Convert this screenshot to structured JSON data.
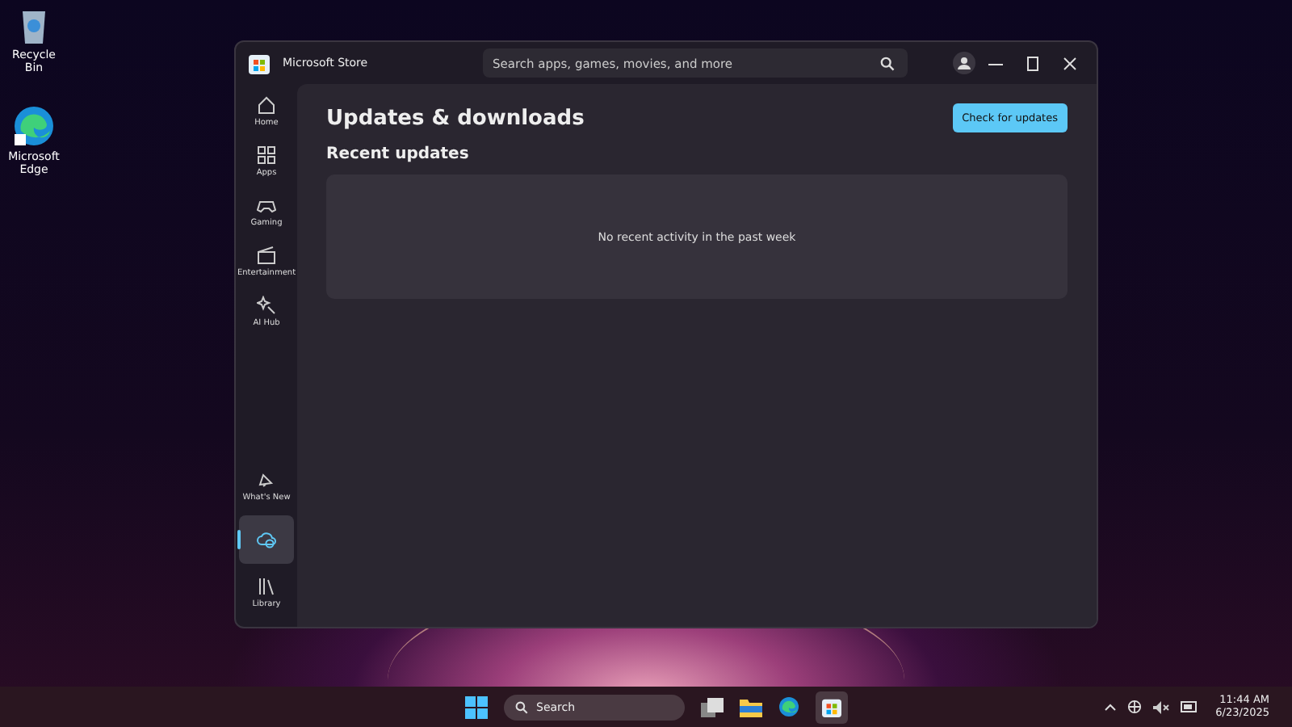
{
  "desktop_icons": [
    {
      "kind": "bin",
      "label": "Recycle Bin"
    },
    {
      "kind": "edge",
      "label": "Microsoft Edge"
    }
  ],
  "window": {
    "title": "Microsoft Store",
    "search": {
      "placeholder": "Search apps, games, movies, and more"
    }
  },
  "sidebar": {
    "items": [
      {
        "kind": "home",
        "label": "Home",
        "selected": false
      },
      {
        "kind": "apps",
        "label": "Apps",
        "selected": false
      },
      {
        "kind": "gaming",
        "label": "Gaming",
        "selected": false
      },
      {
        "kind": "entertainment",
        "label": "Entertainment",
        "selected": false
      },
      {
        "kind": "ai",
        "label": "AI Hub",
        "selected": false
      }
    ],
    "bottom_items": [
      {
        "kind": "whatsnew",
        "label": "What's New",
        "selected": false
      },
      {
        "kind": "downloads",
        "selected": true
      },
      {
        "kind": "library",
        "label": "Library",
        "selected": false
      }
    ]
  },
  "main": {
    "title": "Updates & downloads",
    "button": "Check for updates",
    "section": "Recent updates",
    "empty_message": "No recent activity in the past week"
  },
  "taskbar": {
    "search": "Search",
    "time": "11:44 AM",
    "date": "6/23/2025"
  }
}
